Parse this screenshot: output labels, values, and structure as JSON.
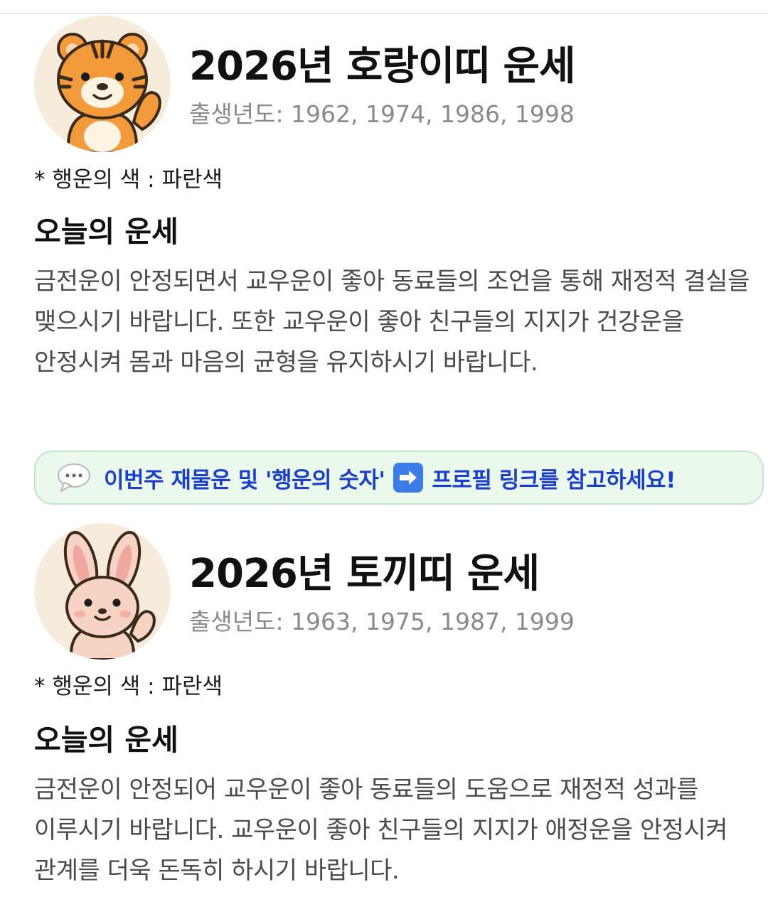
{
  "sections": [
    {
      "title": "2026년 호랑이띠 운세",
      "birth_years": "출생년도: 1962, 1974, 1986, 1998",
      "lucky_color": "* 행운의 색 : 파란색",
      "heading": "오늘의 운세",
      "body": "금전운이 안정되면서 교우운이 좋아 동료들의 조언을 통해 재정적 결실을 맺으시기 바랍니다. 또한 교우운이 좋아 친구들의 지지가 건강운을 안정시켜 몸과 마음의 균형을 유지하시기 바랍니다.",
      "avatar_icon": "tiger-icon"
    },
    {
      "title": "2026년 토끼띠 운세",
      "birth_years": "출생년도: 1963, 1975, 1987, 1999",
      "lucky_color": "* 행운의 색 : 파란색",
      "heading": "오늘의 운세",
      "body": "금전운이 안정되어 교우운이 좋아 동료들의 도움으로 재정적 성과를 이루시기 바랍니다. 교우운이 좋아 친구들의 지지가 애정운을 안정시켜 관계를 더욱 돈독히 하시기 바랍니다.",
      "avatar_icon": "rabbit-icon"
    }
  ],
  "banner": {
    "part1": "이번주 재물운 및 '행운의 숫자'",
    "part2": "프로필 링크를 참고하세요!",
    "icons": [
      "speech-bubble-icon",
      "right-arrow-icon"
    ],
    "colors": {
      "text": "#1a3fd0",
      "background": "#eaf9ec",
      "border": "#bfe8c6"
    }
  }
}
